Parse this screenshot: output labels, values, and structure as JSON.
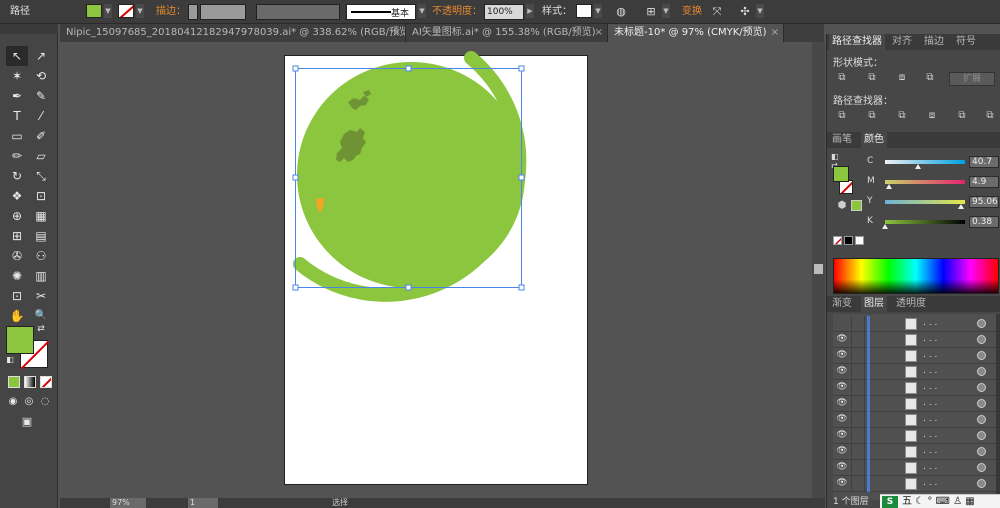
{
  "control_bar": {
    "object_type": "路径",
    "stroke_label": "描边：",
    "stroke_style": "基本",
    "opacity_label": "不透明度：",
    "opacity_value": "100%",
    "style_label": "样式：",
    "transform_label": "变换",
    "fill_color": "#8cc63f"
  },
  "tabs": [
    {
      "label": "Nipic_15097685_20180412182947978039.ai* @ 338.62% (RGB/预览)",
      "active": false
    },
    {
      "label": "AI矢量图标.ai* @ 155.38% (RGB/预览)",
      "active": false
    },
    {
      "label": "未标题-10* @ 97% (CMYK/预览)",
      "active": true
    }
  ],
  "tab_close": "×",
  "tools": {
    "selection": "↖",
    "direct_selection": "↗",
    "magic_wand": "✶",
    "lasso": "⟲",
    "pen": "✒",
    "curvature": "✎",
    "type": "T",
    "line": "⁄",
    "rectangle": "▭",
    "paintbrush": "✐",
    "pencil": "✏",
    "eraser": "▱",
    "rotate": "↻",
    "scale": "⤡",
    "warp": "❖",
    "free_transform": "⊡",
    "shape_builder": "⊕",
    "chart": "▦",
    "mesh": "⊞",
    "gradient": "▤",
    "eyedropper": "✇",
    "blend": "⚇",
    "symbol_sprayer": "✺",
    "column_graph": "▥",
    "artboard": "⊡",
    "slice": "✂",
    "hand": "✋",
    "zoom": "🔍"
  },
  "fill_stroke": {
    "fill": "#8cc63f",
    "stroke": "none"
  },
  "color_modes": {
    "color": "#8cc63f",
    "gradient": "gradient",
    "none": "none"
  },
  "artwork": {
    "main_color": "#8cc63f",
    "continent_color": "#6f9234",
    "marker_color": "#f5a623"
  },
  "status": {
    "zoom": "97%",
    "page": "1",
    "tool_name": "选择"
  },
  "panels": {
    "pathfinder": {
      "tabs": [
        "路径查找器",
        "对齐",
        "描边",
        "符号"
      ],
      "shape_modes_label": "形状模式：",
      "expand_label": "扩展",
      "pathfinders_label": "路径查找器："
    },
    "color": {
      "tabs": [
        "画笔",
        "颜色"
      ],
      "channels": [
        {
          "name": "C",
          "value": "40.7",
          "pct": 0.407,
          "gradient": "linear-gradient(to right,#f0f0f0,#00a0e0)"
        },
        {
          "name": "M",
          "value": "4.9",
          "pct": 0.049,
          "gradient": "linear-gradient(to right,#c8d36a,#e5236e)"
        },
        {
          "name": "Y",
          "value": "95.06",
          "pct": 0.9506,
          "gradient": "linear-gradient(to right,#6fb0d8,#e3e645)"
        },
        {
          "name": "K",
          "value": "0.38",
          "pct": 0.0038,
          "gradient": "linear-gradient(to right,#8cc63f,#000000)"
        }
      ]
    },
    "layers": {
      "tabs": [
        "渐变",
        "图层",
        "透明度"
      ],
      "rows": [
        {
          "name": ". . ."
        },
        {
          "name": ". . ."
        },
        {
          "name": ". . ."
        },
        {
          "name": ". . ."
        },
        {
          "name": ". . ."
        },
        {
          "name": ". . ."
        },
        {
          "name": ". . ."
        },
        {
          "name": ". . ."
        },
        {
          "name": ". . ."
        },
        {
          "name": ". . ."
        },
        {
          "name": ". . ."
        }
      ],
      "eye": "👁",
      "footer": "1 个图层"
    }
  },
  "ime": {
    "logo": "S",
    "text": "五 ☾ ° ⌨ ♙ ▦"
  }
}
